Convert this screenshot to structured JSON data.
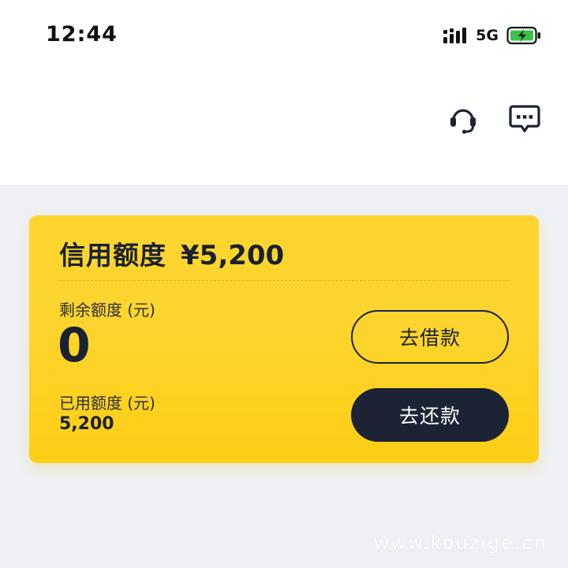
{
  "status_bar": {
    "time": "12:44",
    "network": "5G",
    "icons": [
      "signal-icon",
      "battery-charging-icon"
    ]
  },
  "nav": {
    "icons": [
      "headset-support-icon",
      "message-icon"
    ]
  },
  "credit_card": {
    "title": "信用额度",
    "limit": "¥5,200",
    "remaining_label": "剩余额度 (元)",
    "remaining_value": "0",
    "used_label": "已用额度 (元)",
    "used_value": "5,200",
    "borrow_button": "去借款",
    "repay_button": "去还款"
  },
  "watermark": "www.kouzige.cn",
  "colors": {
    "card_yellow": "#fed42e",
    "dark_navy": "#1b2334",
    "page_bg": "#eef0f4",
    "battery_green": "#39c24a"
  }
}
